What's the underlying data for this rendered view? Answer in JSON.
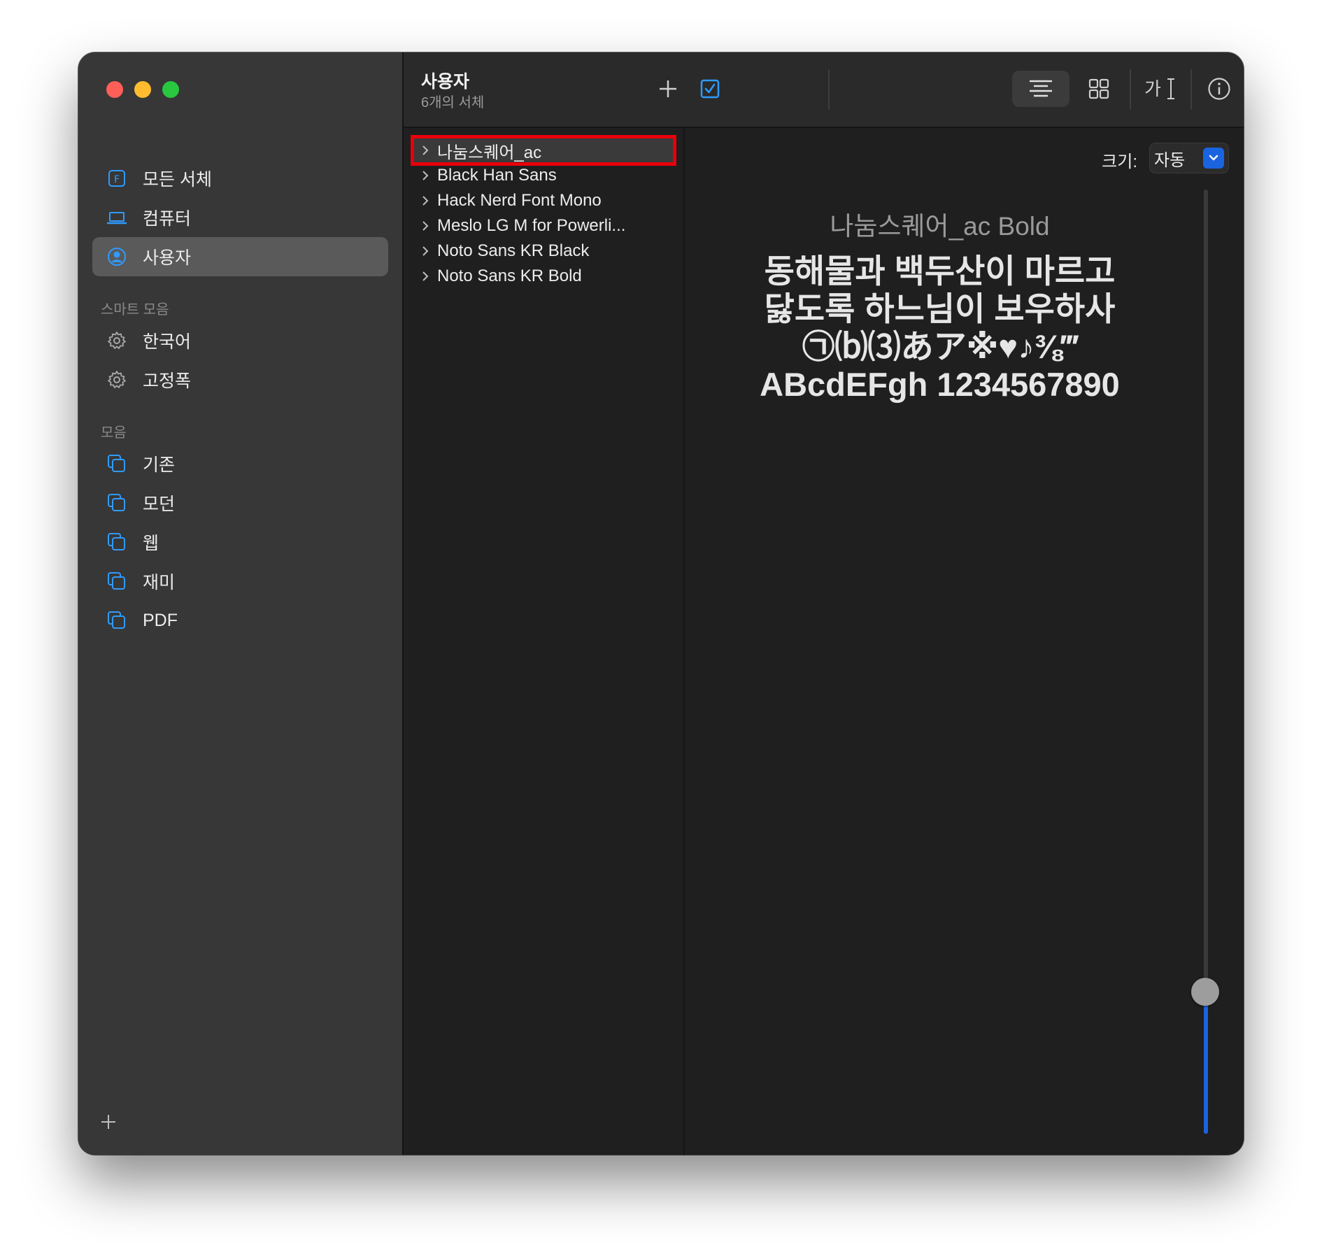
{
  "sidebar": {
    "items": [
      {
        "label": "모든 서체",
        "icon": "font-book-icon"
      },
      {
        "label": "컴퓨터",
        "icon": "laptop-icon"
      },
      {
        "label": "사용자",
        "icon": "user-icon",
        "selected": true
      }
    ],
    "smart_section": "스마트 모음",
    "smart_items": [
      {
        "label": "한국어",
        "icon": "gear-icon"
      },
      {
        "label": "고정폭",
        "icon": "gear-icon"
      }
    ],
    "collections_section": "모음",
    "collections": [
      {
        "label": "기존",
        "icon": "collection-icon"
      },
      {
        "label": "모던",
        "icon": "collection-icon"
      },
      {
        "label": "웹",
        "icon": "collection-icon"
      },
      {
        "label": "재미",
        "icon": "collection-icon"
      },
      {
        "label": "PDF",
        "icon": "collection-icon"
      }
    ]
  },
  "toolbar": {
    "title": "사용자",
    "subtitle": "6개의 서체"
  },
  "fonts": [
    {
      "name": "나눔스퀘어_ac",
      "selected": true
    },
    {
      "name": "Black Han Sans"
    },
    {
      "name": "Hack Nerd Font Mono"
    },
    {
      "name": "Meslo LG M for Powerli..."
    },
    {
      "name": "Noto Sans KR Black"
    },
    {
      "name": "Noto Sans KR Bold"
    }
  ],
  "preview": {
    "size_label": "크기:",
    "size_value": "자동",
    "font_name": "나눔스퀘어_ac Bold",
    "sample_lines": [
      "동해물과 백두산이 마르고",
      "닳도록 하느님이 보우하사",
      "㉠⒝⑶あア※♥♪⅜‴",
      "ABcdEFgh 1234567890"
    ],
    "slider_level": 0.15
  },
  "colors": {
    "accent": "#1a64e0",
    "highlight_border": "#e8000b",
    "sidebar_bg": "#373737",
    "content_bg": "#1f1f1f"
  }
}
